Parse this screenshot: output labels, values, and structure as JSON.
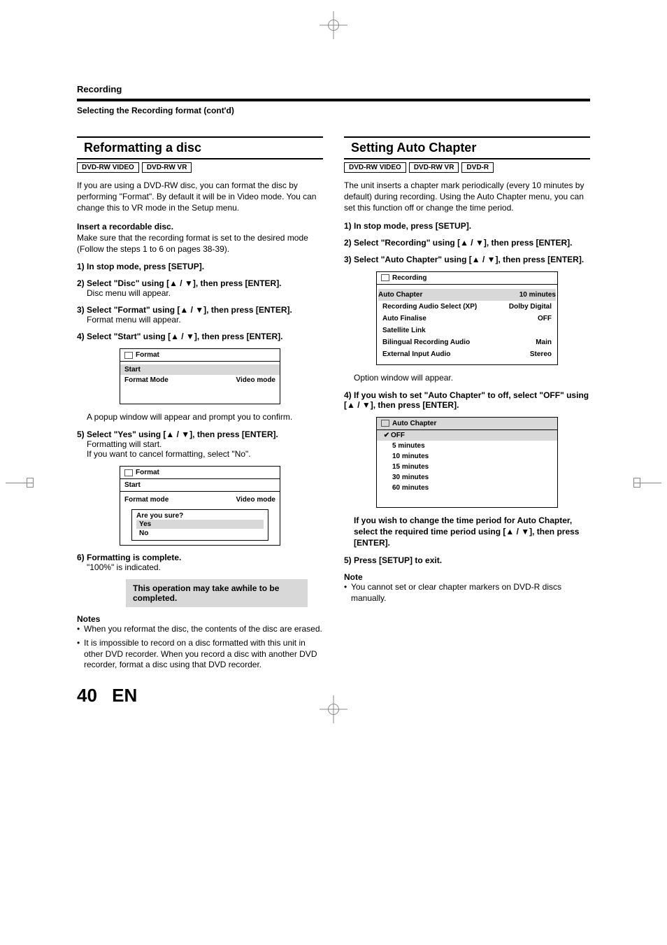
{
  "header": {
    "section": "Recording",
    "subsection": "Selecting the Recording format (cont'd)"
  },
  "left": {
    "title": "Reformatting a disc",
    "badges": [
      "DVD-RW VIDEO",
      "DVD-RW VR"
    ],
    "intro": "If you are using a DVD-RW disc, you can format the disc by performing \"Format\". By default it will be in Video mode. You can change this to VR mode in the Setup menu.",
    "insert_head": "Insert a recordable disc.",
    "insert_body": "Make sure that the recording format is set to the desired mode (Follow the steps 1 to 6 on pages 38-39).",
    "step1": "1) In stop mode, press [SETUP].",
    "step2": "2) Select \"Disc\" using [▲ / ▼], then press [ENTER].",
    "step2_desc": "Disc menu will appear.",
    "step3": "3) Select \"Format\" using  [▲ / ▼], then press [ENTER].",
    "step3_desc": "Format menu will appear.",
    "step4": "4) Select \"Start\" using [▲ / ▼],  then press [ENTER].",
    "menu1": {
      "title": "Format",
      "start": "Start",
      "mode_label": "Format Mode",
      "mode_value": "Video mode"
    },
    "menu1_after": "A popup window will appear and prompt you to confirm.",
    "step5": "5) Select \"Yes\" using [▲ / ▼], then press [ENTER].",
    "step5_desc1": "Formatting will start.",
    "step5_desc2": "If you want to cancel formatting, select \"No\".",
    "menu2": {
      "title": "Format",
      "start": "Start",
      "mode_label": "Format mode",
      "mode_value": "Video mode",
      "popup_q": "Are you sure?",
      "yes": "Yes",
      "no": "No"
    },
    "step6": "6) Formatting is complete.",
    "step6_desc": "\"100%\" is indicated.",
    "warn": "This operation may take awhile to be completed.",
    "notes_head": "Notes",
    "note1": "When you reformat the disc, the contents of the disc are erased.",
    "note2": "It is impossible to record on a disc formatted with this unit in other DVD recorder. When you record a disc with another DVD recorder, format a disc using that DVD recorder."
  },
  "right": {
    "title": "Setting Auto Chapter",
    "badges": [
      "DVD-RW VIDEO",
      "DVD-RW VR",
      "DVD-R"
    ],
    "intro": "The unit inserts a chapter mark periodically (every 10 minutes by default) during recording. Using the Auto Chapter menu, you can set this function off or change the time period.",
    "step1": "1) In stop mode, press [SETUP].",
    "step2": "2) Select \"Recording\" using [▲ / ▼], then press [ENTER].",
    "step3": "3) Select \"Auto Chapter\" using [▲ / ▼], then press [ENTER].",
    "rec_menu": {
      "title": "Recording",
      "rows": [
        {
          "label": "Auto Chapter",
          "value": "10 minutes"
        },
        {
          "label": "Recording Audio Select (XP)",
          "value": "Dolby Digital"
        },
        {
          "label": "Auto Finalise",
          "value": "OFF"
        },
        {
          "label": "Satellite Link",
          "value": ""
        },
        {
          "label": "Bilingual Recording Audio",
          "value": "Main"
        },
        {
          "label": "External Input Audio",
          "value": "Stereo"
        }
      ]
    },
    "rec_after": "Option window will appear.",
    "step4": "4) If you wish to set \"Auto Chapter\" to off, select \"OFF\" using [▲ / ▼], then press [ENTER].",
    "ac_menu": {
      "title": "Auto Chapter",
      "options": [
        "OFF",
        "5 minutes",
        "10 minutes",
        "15 minutes",
        "30 minutes",
        "60 minutes"
      ]
    },
    "step4_desc": "If you wish to change the time period for Auto Chapter, select the required time period using [▲ / ▼], then press [ENTER].",
    "step5": "5) Press [SETUP] to exit.",
    "note_head": "Note",
    "note1": "You cannot set or clear chapter markers on DVD-R discs manually."
  },
  "footer": {
    "page": "40",
    "lang": "EN"
  }
}
